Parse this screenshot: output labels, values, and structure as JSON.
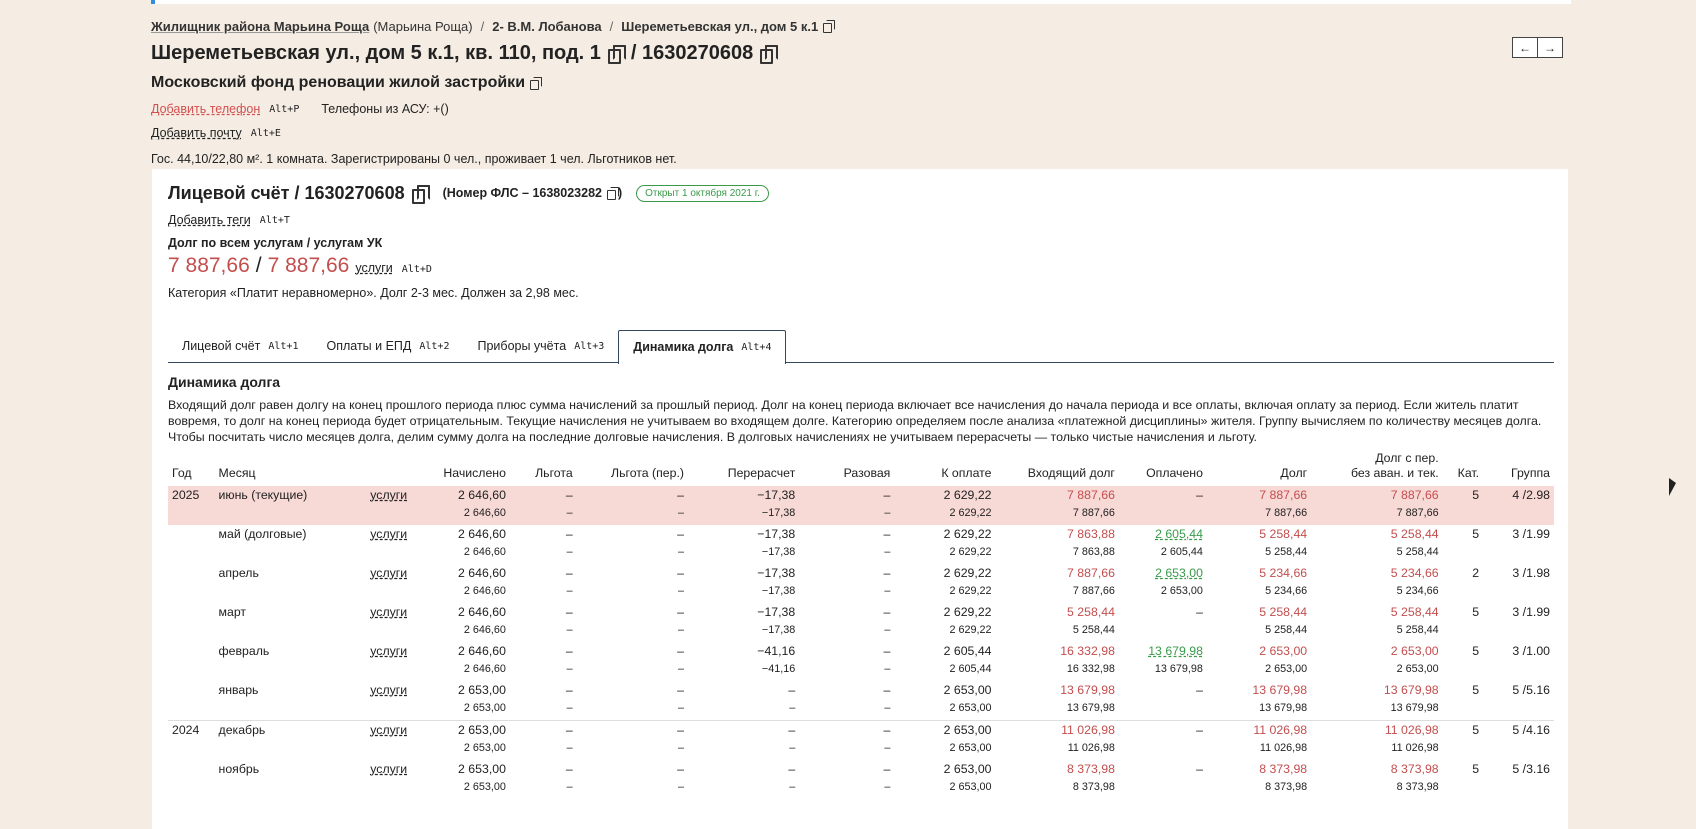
{
  "breadcrumb": {
    "zhilnik": "Жилищник района Марьина Роща",
    "district": "(Марьина Роща)",
    "manager": "2- В.М. Лобанова",
    "house": "Шереметьевская ул., дом 5 к.1"
  },
  "address": {
    "title": "Шереметьевская ул., дом 5 к.1, кв. 110, под. 1",
    "account": "/ 1630270608"
  },
  "org": "Московский фонд реновации жилой застройки",
  "contacts": {
    "add_phone": "Добавить телефон",
    "add_phone_key": "Alt+P",
    "phones_asu": "Телефоны из АСУ: +()",
    "add_email": "Добавить почту",
    "add_email_key": "Alt+E"
  },
  "info_line": "Гос. 44,10/22,80 м². 1 комната. Зарегистрированы 0 чел., проживает 1 чел. Льготников нет.",
  "nav": {
    "prev": "←",
    "next": "→"
  },
  "account": {
    "title": "Лицевой счёт / 1630270608",
    "fls": "(Номер ФЛС – 1638023282",
    "fls_close": ")",
    "badge": "Открыт 1 октября 2021 г.",
    "add_tags": "Добавить теги",
    "add_tags_key": "Alt+T",
    "debt_label": "Долг по всем услугам / услугам УК",
    "debt_all": "7 887,66",
    "debt_slash": "/",
    "debt_uk": "7 887,66",
    "services": "услуги",
    "services_key": "Alt+D",
    "category": "Категория «Платит неравномерно». Долг 2-3 мес. Должен за 2,98 мес."
  },
  "tabs": [
    {
      "label": "Лицевой счёт",
      "key": "Alt+1"
    },
    {
      "label": "Оплаты и ЕПД",
      "key": "Alt+2"
    },
    {
      "label": "Приборы учёта",
      "key": "Alt+3"
    },
    {
      "label": "Динамика долга",
      "key": "Alt+4"
    }
  ],
  "section": {
    "title": "Динамика долга",
    "description": "Входящий долг равен долгу на конец прошлого периода плюс сумма начислений за прошлый период. Долг на конец периода включает все начисления до начала периода и все оплаты, включая оплату за период. Если житель платит вовремя, то долг на конец периода будет отрицательным. Текущие начисления не учитываем во входящем долге. Категорию определяем после анализа «платежной дисциплины» жителя. Группу вычисляем по количеству месяцев долга. Чтобы посчитать число месяцев долга, делим сумму долга на последние долговые начисления. В долговых начислениях не учитываем перерасчеты — только чистые начисления и льготу."
  },
  "table": {
    "headers": {
      "year": "Год",
      "month": "Месяц",
      "charged": "Начислено",
      "benefit": "Льгота",
      "benefit_recalc": "Льгота (пер.)",
      "recalc": "Перерасчет",
      "oneoff": "Разовая",
      "to_pay": "К оплате",
      "incoming": "Входящий долг",
      "paid": "Оплачено",
      "debt": "Долг",
      "debt_ext_1": "Долг с пер.",
      "debt_ext_2": "без аван. и тек.",
      "cat": "Кат.",
      "group": "Группа"
    },
    "rows": [
      {
        "year": "2025",
        "month": "июнь (текущие)",
        "svc": "услуги",
        "charged": "2 646,60",
        "benefit": "–",
        "benefit_recalc": "–",
        "recalc": "−17,38",
        "oneoff": "–",
        "to_pay": "2 629,22",
        "incoming": "7 887,66",
        "paid": "–",
        "debt": "7 887,66",
        "debt_ext": "7 887,66",
        "cat": "5",
        "group": "4 /2.98",
        "sub": {
          "charged": "2 646,60",
          "benefit": "–",
          "benefit_recalc": "–",
          "recalc": "−17,38",
          "oneoff": "–",
          "to_pay": "2 629,22",
          "incoming": "7 887,66",
          "paid": "",
          "debt": "7 887,66",
          "debt_ext": "7 887,66"
        }
      },
      {
        "year": "",
        "month": "май (долговые)",
        "svc": "услуги",
        "charged": "2 646,60",
        "benefit": "–",
        "benefit_recalc": "–",
        "recalc": "−17,38",
        "oneoff": "–",
        "to_pay": "2 629,22",
        "incoming": "7 863,88",
        "paid": "2 605,44",
        "debt": "5 258,44",
        "debt_ext": "5 258,44",
        "cat": "5",
        "group": "3 /1.99",
        "sub": {
          "charged": "2 646,60",
          "benefit": "–",
          "benefit_recalc": "–",
          "recalc": "−17,38",
          "oneoff": "–",
          "to_pay": "2 629,22",
          "incoming": "7 863,88",
          "paid": "2 605,44",
          "debt": "5 258,44",
          "debt_ext": "5 258,44"
        }
      },
      {
        "year": "",
        "month": "апрель",
        "svc": "услуги",
        "charged": "2 646,60",
        "benefit": "–",
        "benefit_recalc": "–",
        "recalc": "−17,38",
        "oneoff": "–",
        "to_pay": "2 629,22",
        "incoming": "7 887,66",
        "paid": "2 653,00",
        "debt": "5 234,66",
        "debt_ext": "5 234,66",
        "cat": "2",
        "group": "3 /1.98",
        "sub": {
          "charged": "2 646,60",
          "benefit": "–",
          "benefit_recalc": "–",
          "recalc": "−17,38",
          "oneoff": "–",
          "to_pay": "2 629,22",
          "incoming": "7 887,66",
          "paid": "2 653,00",
          "debt": "5 234,66",
          "debt_ext": "5 234,66"
        }
      },
      {
        "year": "",
        "month": "март",
        "svc": "услуги",
        "charged": "2 646,60",
        "benefit": "–",
        "benefit_recalc": "–",
        "recalc": "−17,38",
        "oneoff": "–",
        "to_pay": "2 629,22",
        "incoming": "5 258,44",
        "paid": "–",
        "debt": "5 258,44",
        "debt_ext": "5 258,44",
        "cat": "5",
        "group": "3 /1.99",
        "sub": {
          "charged": "2 646,60",
          "benefit": "–",
          "benefit_recalc": "–",
          "recalc": "−17,38",
          "oneoff": "–",
          "to_pay": "2 629,22",
          "incoming": "5 258,44",
          "paid": "",
          "debt": "5 258,44",
          "debt_ext": "5 258,44"
        }
      },
      {
        "year": "",
        "month": "февраль",
        "svc": "услуги",
        "charged": "2 646,60",
        "benefit": "–",
        "benefit_recalc": "–",
        "recalc": "−41,16",
        "oneoff": "–",
        "to_pay": "2 605,44",
        "incoming": "16 332,98",
        "paid": "13 679,98",
        "debt": "2 653,00",
        "debt_ext": "2 653,00",
        "cat": "5",
        "group": "3 /1.00",
        "sub": {
          "charged": "2 646,60",
          "benefit": "–",
          "benefit_recalc": "–",
          "recalc": "−41,16",
          "oneoff": "–",
          "to_pay": "2 605,44",
          "incoming": "16 332,98",
          "paid": "13 679,98",
          "debt": "2 653,00",
          "debt_ext": "2 653,00"
        }
      },
      {
        "year": "",
        "month": "январь",
        "svc": "услуги",
        "charged": "2 653,00",
        "benefit": "–",
        "benefit_recalc": "–",
        "recalc": "–",
        "oneoff": "–",
        "to_pay": "2 653,00",
        "incoming": "13 679,98",
        "paid": "–",
        "debt": "13 679,98",
        "debt_ext": "13 679,98",
        "cat": "5",
        "group": "5 /5.16",
        "sub": {
          "charged": "2 653,00",
          "benefit": "–",
          "benefit_recalc": "–",
          "recalc": "–",
          "oneoff": "–",
          "to_pay": "2 653,00",
          "incoming": "13 679,98",
          "paid": "",
          "debt": "13 679,98",
          "debt_ext": "13 679,98"
        }
      },
      {
        "year": "2024",
        "month": "декабрь",
        "svc": "услуги",
        "charged": "2 653,00",
        "benefit": "–",
        "benefit_recalc": "–",
        "recalc": "–",
        "oneoff": "–",
        "to_pay": "2 653,00",
        "incoming": "11 026,98",
        "paid": "–",
        "debt": "11 026,98",
        "debt_ext": "11 026,98",
        "cat": "5",
        "group": "5 /4.16",
        "sub": {
          "charged": "2 653,00",
          "benefit": "–",
          "benefit_recalc": "–",
          "recalc": "–",
          "oneoff": "–",
          "to_pay": "2 653,00",
          "incoming": "11 026,98",
          "paid": "",
          "debt": "11 026,98",
          "debt_ext": "11 026,98"
        }
      },
      {
        "year": "",
        "month": "ноябрь",
        "svc": "услуги",
        "charged": "2 653,00",
        "benefit": "–",
        "benefit_recalc": "–",
        "recalc": "–",
        "oneoff": "–",
        "to_pay": "2 653,00",
        "incoming": "8 373,98",
        "paid": "–",
        "debt": "8 373,98",
        "debt_ext": "8 373,98",
        "cat": "5",
        "group": "5 /3.16",
        "sub": {
          "charged": "2 653,00",
          "benefit": "–",
          "benefit_recalc": "–",
          "recalc": "–",
          "oneoff": "–",
          "to_pay": "2 653,00",
          "incoming": "8 373,98",
          "paid": "",
          "debt": "8 373,98",
          "debt_ext": "8 373,98"
        }
      }
    ]
  },
  "colors": {
    "background": "#f5ede3",
    "debt_red": "#c34e4e",
    "paid_green": "#3a9a4a",
    "current_row": "#f7d9d6",
    "accent_blue": "#2f8fdc"
  }
}
